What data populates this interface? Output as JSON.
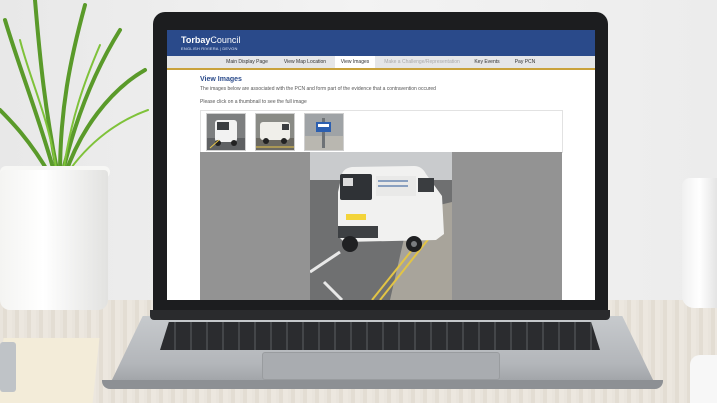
{
  "site": {
    "logo_bold": "Torbay",
    "logo_rest": "Council",
    "logo_sub": "ENGLISH RIVIERA | DEVON",
    "brand_color": "#2a4a8a",
    "accent_color": "#c9a23c"
  },
  "nav": {
    "tabs": [
      {
        "label": "Main Display Page",
        "state": "normal"
      },
      {
        "label": "View Map Location",
        "state": "normal"
      },
      {
        "label": "View Images",
        "state": "active"
      },
      {
        "label": "Make a Challenge/Representation",
        "state": "disabled"
      },
      {
        "label": "Key Events",
        "state": "normal"
      },
      {
        "label": "Pay PCN",
        "state": "normal"
      }
    ]
  },
  "main": {
    "title": "View Images",
    "intro": "The images below are associated with the PCN and form part of the evidence that a contravention occured",
    "instruction": "Please click on a thumbnail to see the full image",
    "thumbnails": [
      {
        "name": "van-rear-thumbnail"
      },
      {
        "name": "van-side-thumbnail"
      },
      {
        "name": "street-sign-thumbnail"
      }
    ],
    "selected_image": "van-rear-full-image"
  }
}
